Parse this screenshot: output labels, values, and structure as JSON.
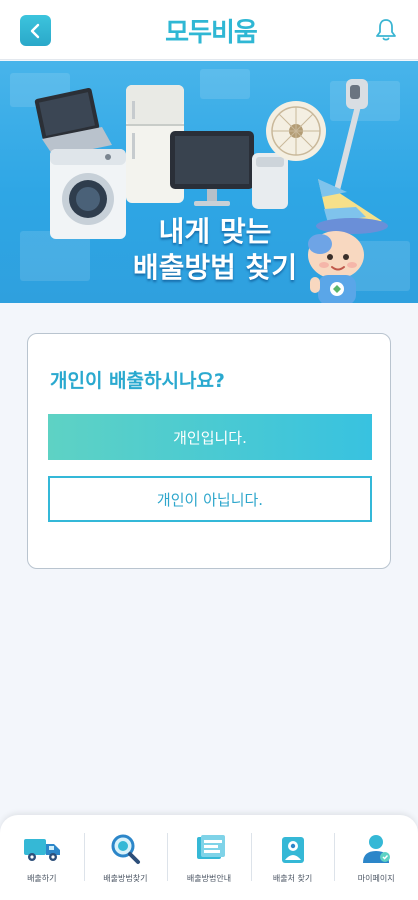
{
  "header": {
    "logo_text": "모두비움",
    "icons": {
      "back": "chevron-left-icon",
      "notifications": "bell-icon"
    }
  },
  "banner": {
    "title_line1": "내게 맞는",
    "title_line2": "배출방법 찾기"
  },
  "question_card": {
    "question": "개인이 배출하시나요?",
    "yes_label": "개인입니다.",
    "no_label": "개인이 아닙니다."
  },
  "bottom_nav": {
    "items": [
      {
        "label": "배출하기",
        "icon": "truck-icon"
      },
      {
        "label": "배출방법찾기",
        "icon": "search-icon"
      },
      {
        "label": "배출방법안내",
        "icon": "guide-icon"
      },
      {
        "label": "배출처 찾기",
        "icon": "location-icon"
      },
      {
        "label": "마이페이지",
        "icon": "user-icon"
      }
    ]
  },
  "colors": {
    "accent": "#2fb7d4",
    "banner_blue": "#2ea6e5",
    "button_gradient_start": "#5ed2c4",
    "button_gradient_end": "#38c2e0",
    "dark_blue": "#2d74c8"
  }
}
